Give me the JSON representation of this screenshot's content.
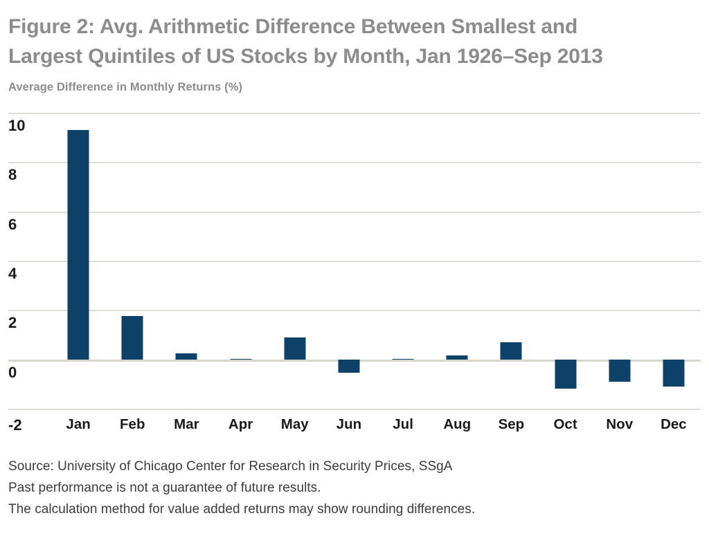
{
  "title": "Figure 2: Avg. Arithmetic Difference Between Smallest and\nLargest Quintiles of US Stocks by Month, Jan 1926–Sep 2013",
  "axis_caption": "Average Difference in Monthly Returns (%)",
  "footnotes": [
    "Source: University of Chicago Center for Research in Security Prices, SSgA",
    "Past performance is not a guarantee of future results.",
    "The calculation method for value added returns may show rounding differences."
  ],
  "colors": {
    "bar": "#0d4168",
    "title": "#8c8c8c",
    "gridline": "#dedcd7",
    "tick_text": "#1a1a1a",
    "footnote_text": "#3b3b3b",
    "background": "#ffffff"
  },
  "chart_data": {
    "type": "bar",
    "title": "Figure 2: Avg. Arithmetic Difference Between Smallest and Largest Quintiles of US Stocks by Month, Jan 1926–Sep 2013",
    "subtitle": "",
    "xlabel": "",
    "ylabel": "Average Difference in Monthly Returns (%)",
    "categories": [
      "Jan",
      "Feb",
      "Mar",
      "Apr",
      "May",
      "Jun",
      "Jul",
      "Aug",
      "Sep",
      "Oct",
      "Nov",
      "Dec"
    ],
    "values": [
      9.3,
      1.75,
      0.25,
      0.02,
      0.9,
      -0.55,
      0.03,
      0.15,
      0.7,
      -1.2,
      -0.9,
      -1.1
    ],
    "ylim": [
      -2,
      10
    ],
    "yticks": [
      10,
      8,
      6,
      4,
      2,
      0,
      -2
    ],
    "ytick_labels": [
      "10",
      "8",
      "6",
      "4",
      "2",
      "0",
      "-2"
    ],
    "grid": true,
    "legend": false,
    "series_color": "#0d4168"
  }
}
